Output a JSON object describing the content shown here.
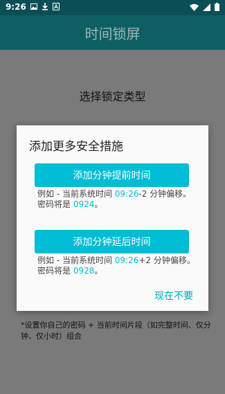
{
  "status_bar": {
    "time": "9:26",
    "left_icons": [
      "image-icon",
      "download-icon",
      "a-badge-icon"
    ],
    "right_icons": [
      "wifi-icon",
      "signal-icon",
      "battery-icon"
    ]
  },
  "app_bar": {
    "title": "时间锁屏"
  },
  "main": {
    "lock_type_label": "选择锁定类型",
    "footnote": "*设置你自己的密码 + 当前时间片段（如完整时间、仅分钟、仅小时）组合"
  },
  "dialog": {
    "title": "添加更多安全措施",
    "options": [
      {
        "button_label": "添加分钟提前时间",
        "hint_prefix": "例如 - 当前系统时间 ",
        "hint_time": "09:26",
        "hint_middle": "-2 分钟偏移。密码将是 ",
        "hint_code": "0924",
        "hint_suffix": "。"
      },
      {
        "button_label": "添加分钟延后时间",
        "hint_prefix": "例如 - 当前系统时间 ",
        "hint_time": "09:26",
        "hint_middle": "+2 分钟偏移。密码将是 ",
        "hint_code": "0928",
        "hint_suffix": "。"
      }
    ],
    "dismiss_label": "现在不要"
  },
  "colors": {
    "accent": "#00bcd4",
    "app_bar": "#0e5f63",
    "scrim": "#7a7a7a"
  }
}
